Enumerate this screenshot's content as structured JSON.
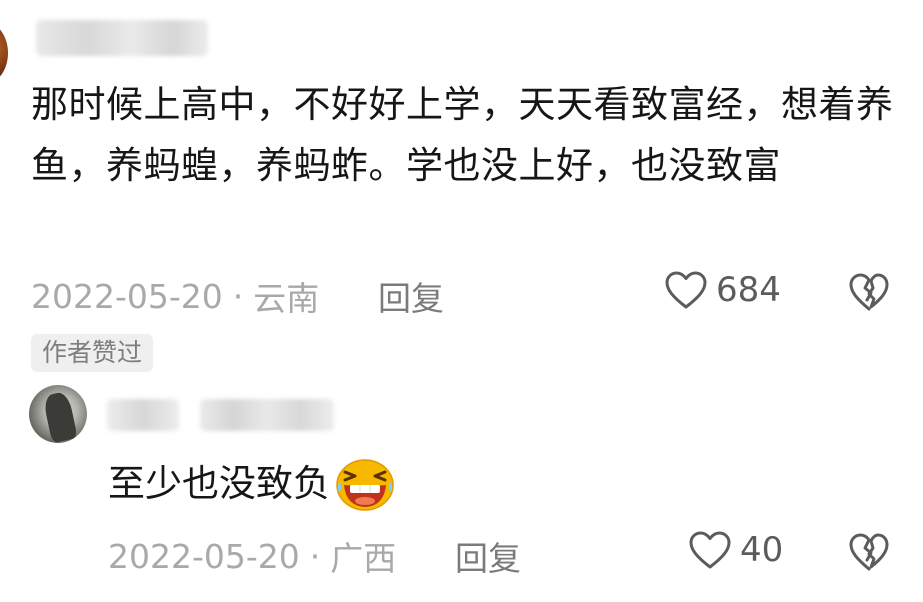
{
  "parent_comment": {
    "text": "那时候上高中，不好好上学，天天看致富经，想着养鱼，养蚂蝗，养蚂蚱。学也没上好，也没致富",
    "date": "2022-05-20",
    "separator": "·",
    "location": "云南",
    "reply_label": "回复",
    "likes": "684",
    "author_badge": "作者赞过"
  },
  "reply_comment": {
    "text": "至少也没致负",
    "emoji": "laughing-face-icon",
    "date": "2022-05-20",
    "separator": "·",
    "location": "广西",
    "reply_label": "回复",
    "likes": "40"
  },
  "colors": {
    "text_primary": "#161616",
    "text_meta": "#a9a9a9",
    "reply_label": "#7b7b7b",
    "badge_bg": "#efefef",
    "emoji_yellow": "#f7b900",
    "emoji_mouth": "#c0321a"
  }
}
